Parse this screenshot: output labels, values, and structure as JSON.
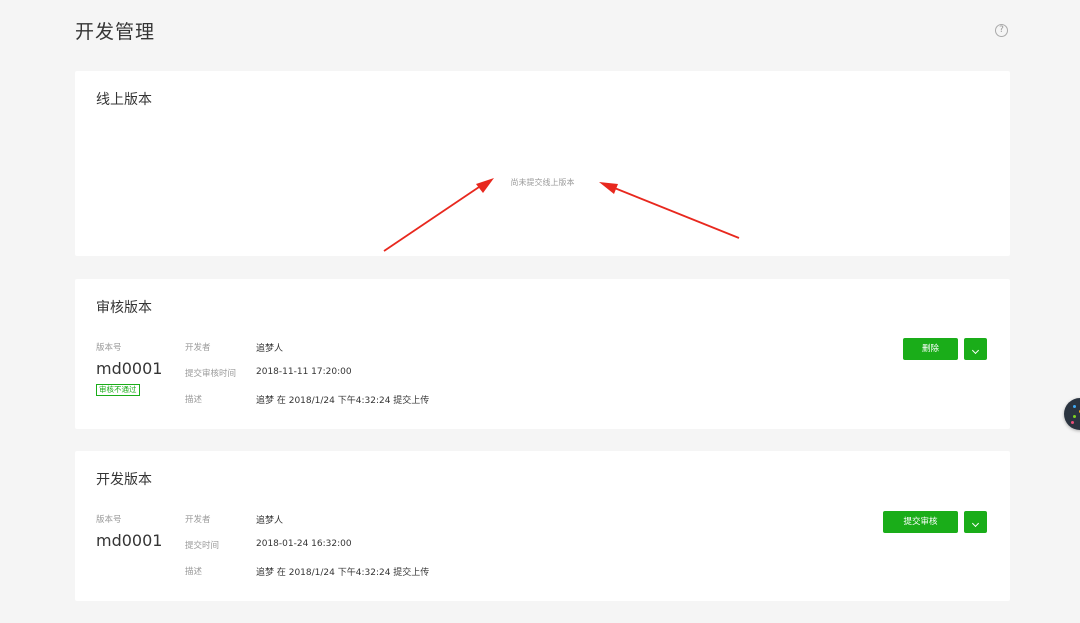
{
  "page": {
    "title": "开发管理",
    "help_icon": "question-circle-icon"
  },
  "online": {
    "title": "线上版本",
    "empty_text": "尚未提交线上版本"
  },
  "review": {
    "title": "审核版本",
    "version_label": "版本号",
    "version": "md0001",
    "status": "审核不通过",
    "fields": [
      {
        "label": "开发者",
        "value": "追梦人"
      },
      {
        "label": "提交审核时间",
        "value": "2018-11-11 17:20:00"
      },
      {
        "label": "描述",
        "value": "追梦 在 2018/1/24 下午4:32:24 提交上传"
      }
    ],
    "action_label": "删除",
    "more_icon": "chevron-down-icon"
  },
  "dev": {
    "title": "开发版本",
    "version_label": "版本号",
    "version": "md0001",
    "fields": [
      {
        "label": "开发者",
        "value": "追梦人"
      },
      {
        "label": "提交时间",
        "value": "2018-01-24 16:32:00"
      },
      {
        "label": "描述",
        "value": "追梦 在 2018/1/24 下午4:32:24 提交上传"
      }
    ],
    "action_label": "提交审核",
    "more_icon": "chevron-down-icon"
  },
  "colors": {
    "brand_green": "#1aad19",
    "annotation_red": "#e8281e",
    "background": "#f5f5f5"
  }
}
